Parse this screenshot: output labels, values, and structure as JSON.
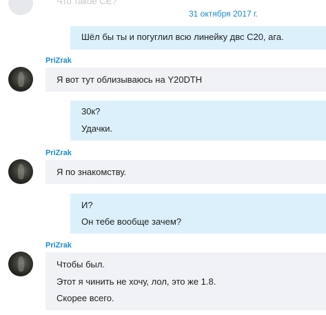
{
  "chat": {
    "faded_top_message": "Что такое CE?",
    "date_separator": "31 октября 2017 г.",
    "messages": [
      {
        "direction": "out",
        "lines": [
          "Шёл бы ты и погуглил всю линейку двс C20, ага."
        ]
      },
      {
        "direction": "in",
        "sender": "PriZrak",
        "lines": [
          "Я вот тут облизываюсь на Y20DTH"
        ]
      },
      {
        "direction": "out",
        "lines": [
          "30к?",
          "Удачки."
        ]
      },
      {
        "direction": "in",
        "sender": "PriZrak",
        "lines": [
          "Я по знакомству."
        ]
      },
      {
        "direction": "out",
        "lines": [
          "И?",
          "Он тебе вообще зачем?"
        ]
      },
      {
        "direction": "in",
        "sender": "PriZrak",
        "lines": [
          "Чтобы был.",
          "Этот я чинить не хочу, лол, это же 1.8.",
          "Скорее всего."
        ]
      }
    ]
  },
  "colors": {
    "incoming_bubble": "#f1f2f5",
    "outgoing_bubble": "#dcf0fc",
    "sender_name": "#168acd",
    "date": "#168acd",
    "faded_text": "#c4c7cc"
  }
}
